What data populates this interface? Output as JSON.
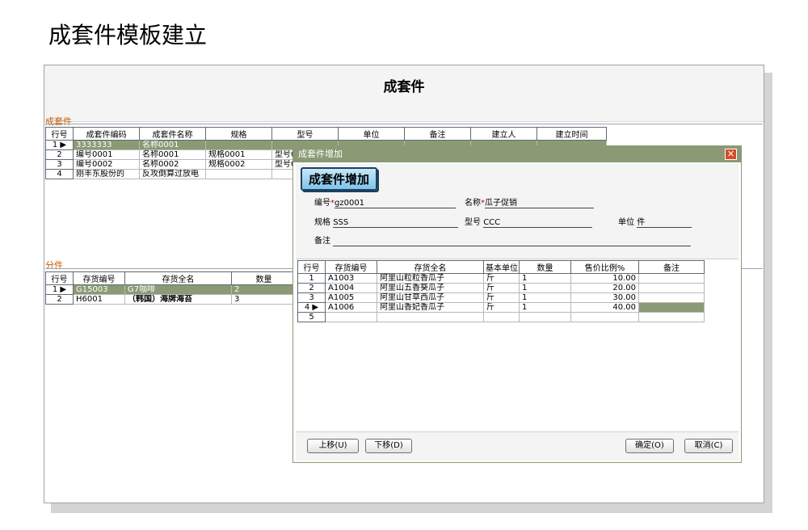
{
  "page_title": "成套件模板建立",
  "window": {
    "title": "成套件"
  },
  "kit": {
    "section_label": "成套件",
    "columns": [
      "行号",
      "成套件编码",
      "成套件名称",
      "规格",
      "型号",
      "单位",
      "备注",
      "建立人",
      "建立时间"
    ],
    "rows": [
      {
        "n": "1",
        "code": "3333333",
        "name": "名称0001",
        "spec": "",
        "model": "",
        "unit": "",
        "note": "",
        "creator": "",
        "time": ""
      },
      {
        "n": "2",
        "code": "编号0001",
        "name": "名称0001",
        "spec": "规格0001",
        "model": "型号0",
        "unit": "",
        "note": "",
        "creator": "",
        "time": ""
      },
      {
        "n": "3",
        "code": "编号0002",
        "name": "名称0002",
        "spec": "规格0002",
        "model": "型号0",
        "unit": "",
        "note": "",
        "creator": "",
        "time": ""
      },
      {
        "n": "4",
        "code": "刚丰东股份的",
        "name": "反攻倒算过放电",
        "spec": "",
        "model": "",
        "unit": "",
        "note": "",
        "creator": "",
        "time": ""
      }
    ]
  },
  "parts": {
    "section_label": "分件",
    "columns": [
      "行号",
      "存货编号",
      "存货全名",
      "数量"
    ],
    "rows": [
      {
        "n": "1",
        "code": "G15003",
        "name": "G7咖啡",
        "qty": "2"
      },
      {
        "n": "2",
        "code": "H6001",
        "name": "（韩国）海牌海苔",
        "qty": "3"
      }
    ]
  },
  "dialog": {
    "title": "成套件增加",
    "close": "✕",
    "form_button": "成套件增加",
    "code_label": "编号",
    "code_value": "gz0001",
    "name_label": "名称",
    "name_value": "瓜子促销",
    "spec_label": "规格",
    "spec_value": "SSS",
    "model_label": "型号",
    "model_value": "CCC",
    "unit_label": "单位",
    "unit_value": "件",
    "note_label": "备注",
    "note_value": "",
    "columns": [
      "行号",
      "存货编号",
      "存货全名",
      "基本单位",
      "数量",
      "售价比例%",
      "备注"
    ],
    "rows": [
      {
        "n": "1",
        "code": "A1003",
        "name": "阿里山粒粒香瓜子",
        "unit": "斤",
        "qty": "1",
        "ratio": "10.00",
        "note": ""
      },
      {
        "n": "2",
        "code": "A1004",
        "name": "阿里山五香葵瓜子",
        "unit": "斤",
        "qty": "1",
        "ratio": "20.00",
        "note": ""
      },
      {
        "n": "3",
        "code": "A1005",
        "name": "阿里山甘草西瓜子",
        "unit": "斤",
        "qty": "1",
        "ratio": "30.00",
        "note": ""
      },
      {
        "n": "4",
        "code": "A1006",
        "name": "阿里山香妃香瓜子",
        "unit": "斤",
        "qty": "1",
        "ratio": "40.00",
        "note": ""
      },
      {
        "n": "5",
        "code": "",
        "name": "",
        "unit": "",
        "qty": "",
        "ratio": "",
        "note": ""
      }
    ],
    "btn_up": "上移(U)",
    "btn_down": "下移(D)",
    "btn_ok": "确定(O)",
    "btn_cancel": "取消(C)"
  },
  "colors": {
    "selection": "#8a9a74",
    "section_label": "#c35a00",
    "close_button": "#d84a2a"
  },
  "icons": {
    "row_pointer": "row-pointer-icon",
    "close": "close-icon"
  }
}
